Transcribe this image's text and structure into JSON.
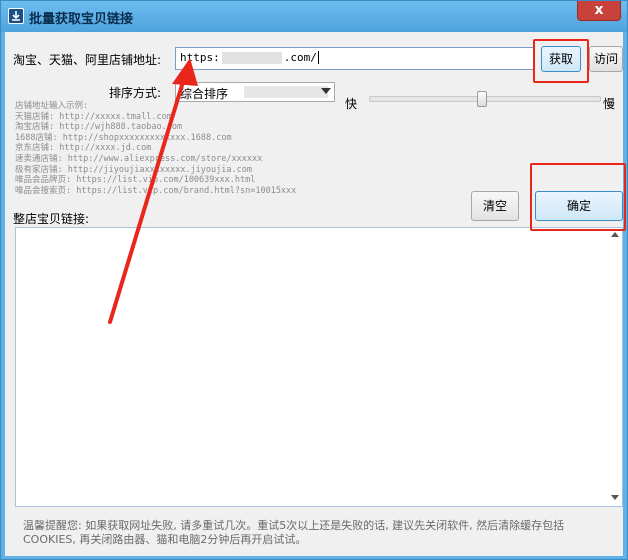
{
  "window": {
    "title": "批量获取宝贝链接",
    "close_label": "x"
  },
  "form": {
    "url_label": "淘宝、天猫、阿里店铺地址:",
    "url_value_start": "https:",
    "url_value_end": ".com/",
    "fetch_button": "获取",
    "visit_button": "访问",
    "sort_label": "排序方式:",
    "sort_selected": "综合排序",
    "speed_fast": "快",
    "speed_slow": "慢",
    "speed_level": 0.48
  },
  "examples": {
    "heading": "店铺地址输入示例:",
    "lines": [
      "天猫店铺: http://xxxxx.tmall.com",
      "淘宝店铺: http://wjh888.taobao.com",
      "1688店铺: http://shopxxxxxxxxxxxxx.1688.com",
      "京东店铺: http://xxxx.jd.com",
      "速卖通店铺: http://www.aliexpress.com/store/xxxxxx",
      "极有家店铺: http://jiyoujiaxxxxxxxx.jiyoujia.com",
      "唯品会品牌页: https://list.vip.com/100639xxx.html",
      "唯品会搜索页: https://list.vip.com/brand.html?sn=10015xxx"
    ]
  },
  "actions": {
    "clear_button": "清空",
    "confirm_button": "确定"
  },
  "links": {
    "label": "整店宝贝链接:"
  },
  "tips": {
    "text": "温馨提醒您: 如果获取网址失败, 请多重试几次。重试5次以上还是失败的话, 建议先关闭软件, 然后清除缓存包括COOKIES, 再关闭路由器、猫和电脑2分钟后再开启试试。"
  },
  "colors": {
    "titlebar": "#5fb1e6",
    "highlight": "#e8261c",
    "arrow": "#e8261c"
  }
}
